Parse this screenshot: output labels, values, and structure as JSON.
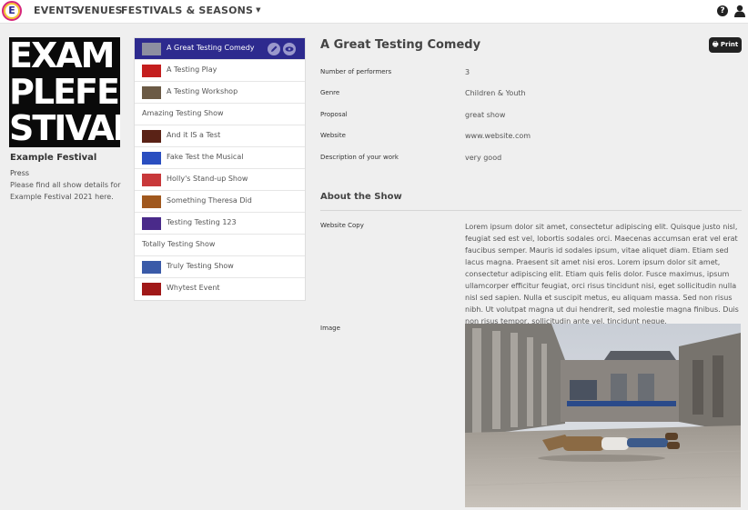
{
  "nav": {
    "brand_letter": "E",
    "events": "EVENTS",
    "venues": "VENUES",
    "festivals": "FESTIVALS & SEASONS"
  },
  "festival": {
    "poster_lines": [
      "EXAM",
      "PLEFE",
      "STIVAL"
    ],
    "name": "Example Festival",
    "subtitle": "Press",
    "description": "Please find all show details for Example Festival 2021 here."
  },
  "shows": [
    {
      "label": "A Great Testing Comedy",
      "thumb": true,
      "active": true,
      "thumb_color": "#8d8fa0"
    },
    {
      "label": "A Testing Play",
      "thumb": true,
      "active": false,
      "thumb_color": "#c41e1e"
    },
    {
      "label": "A Testing Workshop",
      "thumb": true,
      "active": false,
      "thumb_color": "#6b5a45"
    },
    {
      "label": "Amazing Testing Show",
      "thumb": false,
      "active": false
    },
    {
      "label": "And it IS a Test",
      "thumb": true,
      "active": false,
      "thumb_color": "#5a2216"
    },
    {
      "label": "Fake Test the Musical",
      "thumb": true,
      "active": false,
      "thumb_color": "#2a4ec0"
    },
    {
      "label": "Holly's Stand-up Show",
      "thumb": true,
      "active": false,
      "thumb_color": "#c8383a"
    },
    {
      "label": "Something Theresa Did",
      "thumb": true,
      "active": false,
      "thumb_color": "#a0581e"
    },
    {
      "label": "Testing Testing 123",
      "thumb": true,
      "active": false,
      "thumb_color": "#4a2a8a"
    },
    {
      "label": "Totally Testing Show",
      "thumb": false,
      "active": false
    },
    {
      "label": "Truly Testing Show",
      "thumb": true,
      "active": false,
      "thumb_color": "#3a5aa8"
    },
    {
      "label": "Whytest Event",
      "thumb": true,
      "active": false,
      "thumb_color": "#a01818"
    }
  ],
  "detail": {
    "title": "A Great Testing Comedy",
    "print_label": "Print",
    "fields": [
      {
        "label": "Number of performers",
        "value": "3"
      },
      {
        "label": "Genre",
        "value": "Children & Youth"
      },
      {
        "label": "Proposal",
        "value": "great show"
      },
      {
        "label": "Website",
        "value": "www.website.com"
      },
      {
        "label": "Description of your work",
        "value": "very good"
      }
    ],
    "about_title": "About the Show",
    "website_copy_label": "Website Copy",
    "website_copy": "Lorem ipsum dolor sit amet, consectetur adipiscing elit. Quisque justo nisl, feugiat sed est vel, lobortis sodales orci. Maecenas accumsan erat vel erat faucibus semper. Mauris id sodales ipsum, vitae aliquet diam. Etiam sed lacus magna. Praesent sit amet nisi eros. Lorem ipsum dolor sit amet, consectetur adipiscing elit. Etiam quis felis dolor. Fusce maximus, ipsum ullamcorper efficitur feugiat, orci risus tincidunt nisi, eget sollicitudin nulla nisl sed sapien. Nulla et suscipit metus, eu aliquam massa. Sed non risus nibh. Ut volutpat magna ut dui hendrerit, sed molestie magna finibus. Duis non risus tempor, sollicitudin ante vel, tincidunt neque.",
    "image_label": "Image"
  },
  "colors": {
    "accent": "#2d2a8e",
    "brand_ring": "#d6267c"
  }
}
